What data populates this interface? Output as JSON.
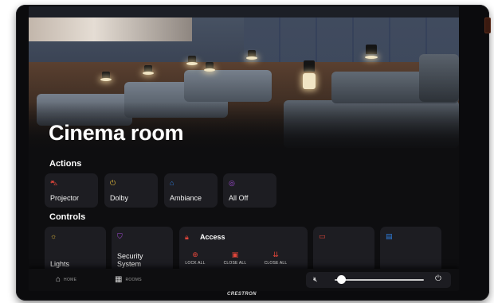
{
  "room": {
    "title": "Cinema room"
  },
  "actions": {
    "heading": "Actions",
    "items": [
      {
        "label": "Projector",
        "icon": "projector-icon",
        "color": "#e0453a"
      },
      {
        "label": "Dolby",
        "icon": "dolby-icon",
        "color": "#d9b23a"
      },
      {
        "label": "Ambiance",
        "icon": "home-icon",
        "color": "#2f7fe0"
      },
      {
        "label": "All Off",
        "icon": "all-off-icon",
        "color": "#a24bd6"
      }
    ]
  },
  "controls": {
    "heading": "Controls",
    "lights": {
      "label": "Lights",
      "icon": "lightbulb-icon",
      "color": "#d9b23a"
    },
    "security": {
      "label": "Security\nSystem",
      "icon": "shield-icon",
      "color": "#a24bd6"
    },
    "access": {
      "title": "Access",
      "icon": "lock-icon",
      "color": "#e0453a",
      "buttons": [
        {
          "label": "LOCK ALL",
          "icon": "lock-icon"
        },
        {
          "label": "CLOSE ALL",
          "icon": "shade-icon"
        },
        {
          "label": "CLOSE ALL",
          "icon": "curtain-icon"
        }
      ]
    },
    "camera": {
      "icon": "camera-icon",
      "color": "#e0453a"
    },
    "other": {
      "icon": "panel-icon",
      "color": "#2f7fe0"
    }
  },
  "nav": {
    "home_label": "HOME",
    "rooms_label": "ROOMS"
  },
  "volume": {
    "level": 0.08
  },
  "brand": "CRESTRON"
}
